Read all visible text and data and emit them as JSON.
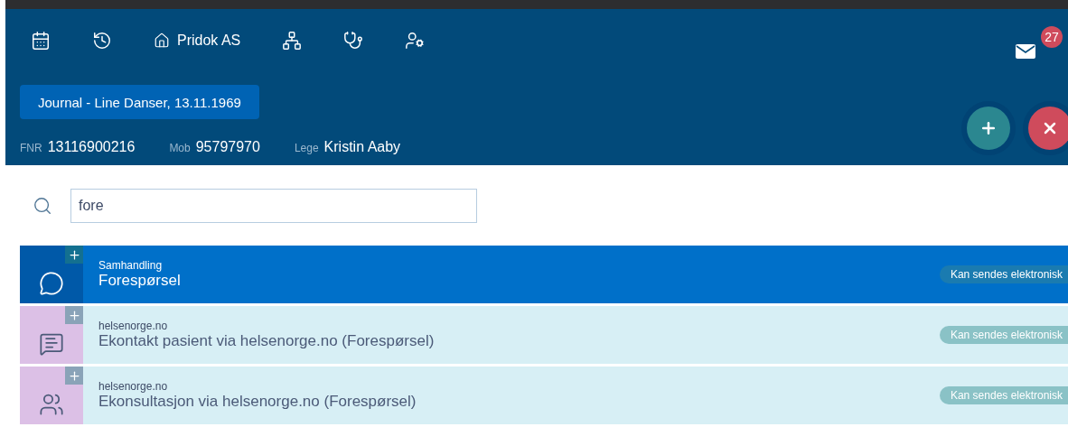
{
  "toolbar": {
    "items": [
      {
        "kind": "calendar"
      },
      {
        "kind": "history"
      },
      {
        "kind": "home",
        "label": "Pridok AS"
      },
      {
        "kind": "hierarchy"
      },
      {
        "kind": "doctor"
      },
      {
        "kind": "user-settings"
      }
    ]
  },
  "messages": {
    "count": "27"
  },
  "journal_tab": {
    "label": "Journal - Line Danser, 13.11.1969"
  },
  "patient": [
    {
      "label": "FNR",
      "value": "13116900216"
    },
    {
      "label": "Mob",
      "value": "95797970"
    },
    {
      "label": "Lege",
      "value": "Kristin Aaby"
    }
  ],
  "actions": [
    {
      "kind": "add"
    },
    {
      "kind": "close"
    }
  ],
  "search": {
    "value": "fore"
  },
  "results": [
    {
      "kind": "chat",
      "selected": true,
      "category": "Samhandling",
      "title": "Forespørsel",
      "badge": "Kan sendes elektronisk"
    },
    {
      "kind": "chat-lines",
      "selected": false,
      "category": "helsenorge.no",
      "title": "Ekontakt pasient via helsenorge.no (Forespørsel)",
      "badge": "Kan sendes elektronisk"
    },
    {
      "kind": "people",
      "selected": false,
      "category": "helsenorge.no",
      "title": "Ekonsultasjon via helsenorge.no (Forespørsel)",
      "badge": "Kan sendes elektronisk"
    }
  ]
}
